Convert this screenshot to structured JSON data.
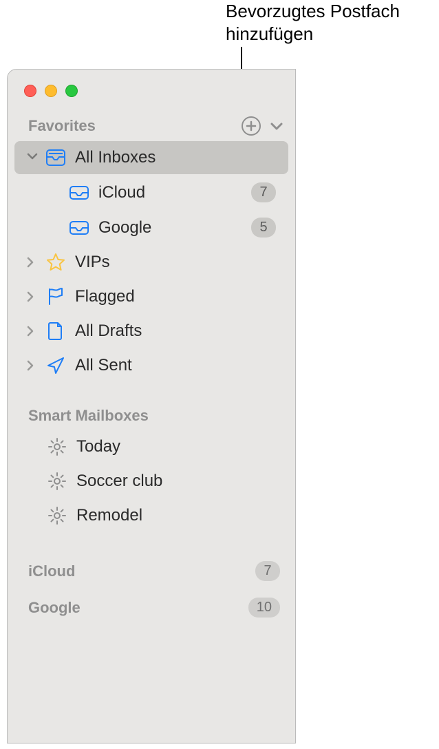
{
  "callout": "Bevorzugtes Postfach hinzufügen",
  "favorites": {
    "header": "Favorites",
    "items": [
      {
        "label": "All Inboxes",
        "type": "inbox-all",
        "expanded": true,
        "selected": true
      },
      {
        "label": "iCloud",
        "type": "inbox",
        "indent": true,
        "badge": "7"
      },
      {
        "label": "Google",
        "type": "inbox",
        "indent": true,
        "badge": "5"
      },
      {
        "label": "VIPs",
        "type": "star",
        "expandable": true
      },
      {
        "label": "Flagged",
        "type": "flag",
        "expandable": true
      },
      {
        "label": "All Drafts",
        "type": "draft",
        "expandable": true
      },
      {
        "label": "All Sent",
        "type": "sent",
        "expandable": true
      }
    ]
  },
  "smart": {
    "header": "Smart Mailboxes",
    "items": [
      {
        "label": "Today"
      },
      {
        "label": "Soccer club"
      },
      {
        "label": "Remodel"
      }
    ]
  },
  "accounts": [
    {
      "label": "iCloud",
      "badge": "7"
    },
    {
      "label": "Google",
      "badge": "10"
    }
  ],
  "colors": {
    "accent": "#1f7ef6",
    "star": "#f9c441",
    "grey": "#8f8f8f"
  }
}
